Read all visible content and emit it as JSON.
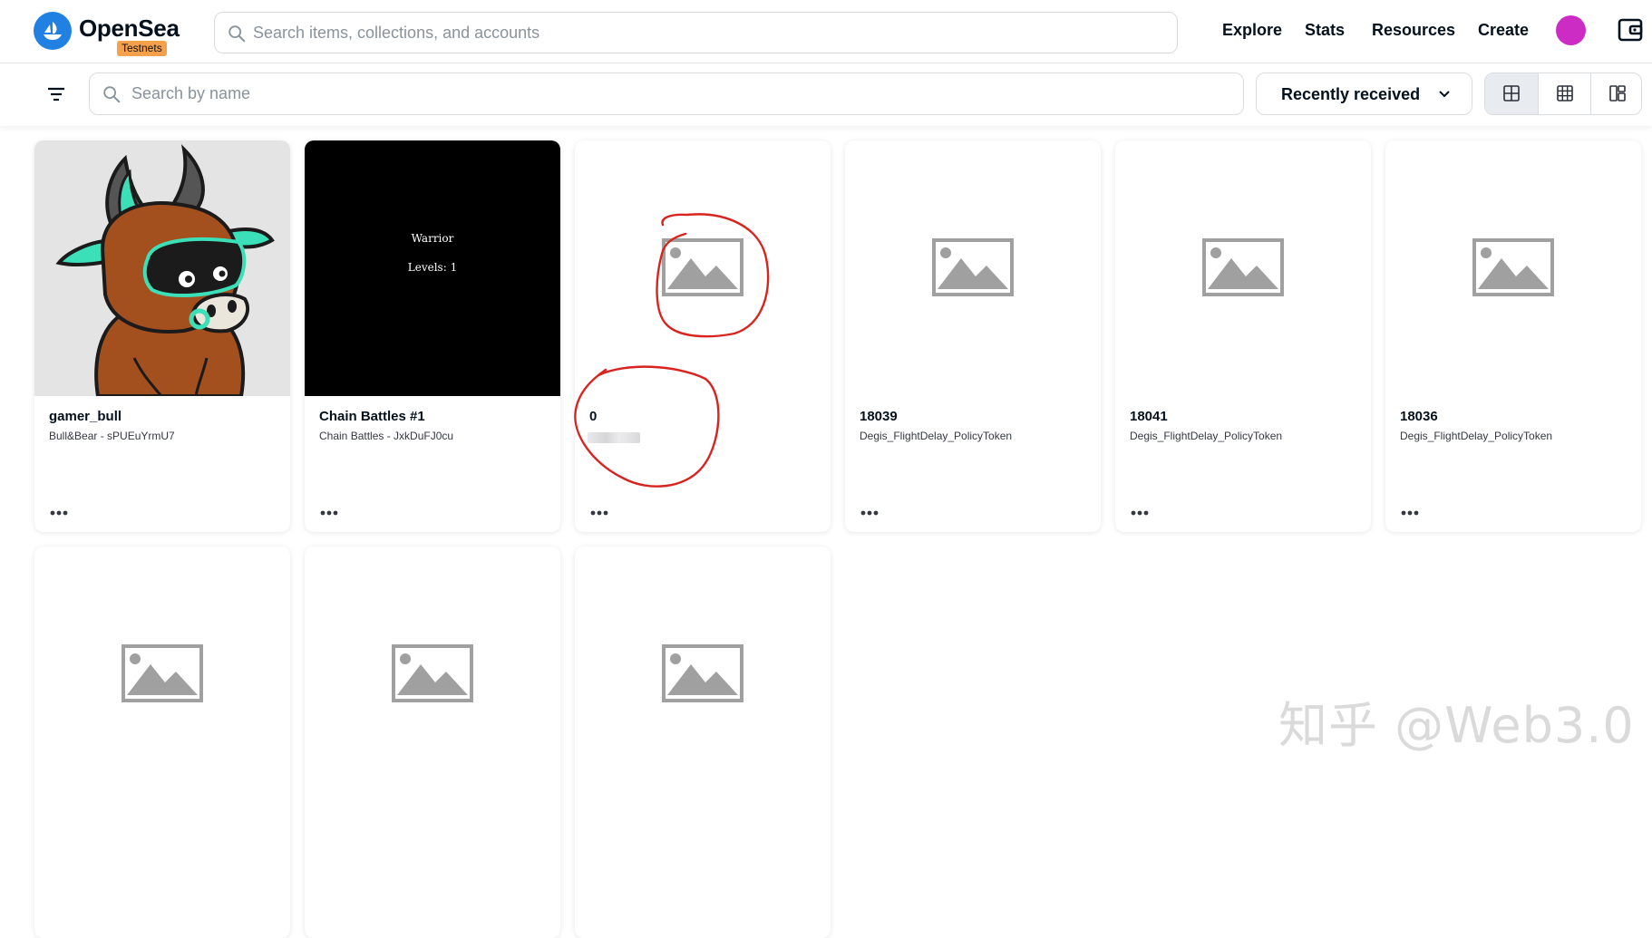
{
  "app": {
    "brand": "OpenSea",
    "badge": "Testnets",
    "colors": {
      "accent": "#2081e2",
      "badge": "#f5a04a",
      "avatar": "#cc2cc4",
      "annotation": "#d9231f"
    }
  },
  "header": {
    "search_placeholder": "Search items, collections, and accounts",
    "nav": [
      "Explore",
      "Stats",
      "Resources",
      "Create"
    ]
  },
  "toolbar": {
    "search_placeholder": "Search by name",
    "sort_label": "Recently received",
    "views": [
      "large-grid-icon",
      "small-grid-icon",
      "mosaic-icon"
    ],
    "active_view": "large-grid-icon"
  },
  "items": [
    {
      "title": "gamer_bull",
      "subtitle": "Bull&Bear - sPUEuYrmU7",
      "media": "bull-image"
    },
    {
      "title": "Chain Battles #1",
      "subtitle": "Chain Battles - JxkDuFJ0cu",
      "media": "warrior-svg",
      "media_text": [
        "Warrior",
        "Levels: 1"
      ]
    },
    {
      "title": "0",
      "subtitle": "",
      "media": "placeholder-image-icon"
    },
    {
      "title": "18039",
      "subtitle": "Degis_FlightDelay_PolicyToken",
      "media": "placeholder-image-icon"
    },
    {
      "title": "18041",
      "subtitle": "Degis_FlightDelay_PolicyToken",
      "media": "placeholder-image-icon"
    },
    {
      "title": "18036",
      "subtitle": "Degis_FlightDelay_PolicyToken",
      "media": "placeholder-image-icon"
    },
    {
      "title": "",
      "subtitle": "",
      "media": "placeholder-image-icon"
    },
    {
      "title": "",
      "subtitle": "",
      "media": "placeholder-image-icon"
    },
    {
      "title": "",
      "subtitle": "",
      "media": "placeholder-image-icon"
    }
  ],
  "watermark": "知乎 @Web3.0"
}
